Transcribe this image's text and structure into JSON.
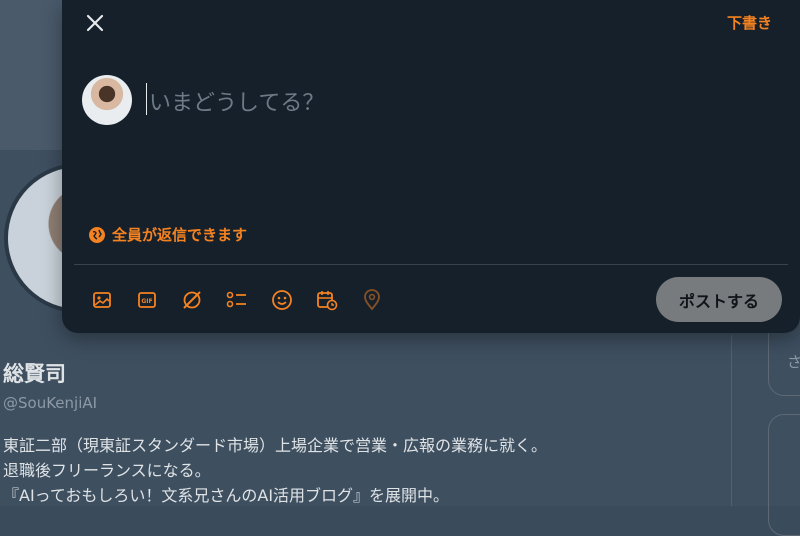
{
  "compose": {
    "draft_label": "下書き",
    "placeholder": "いまどうしてる？",
    "reply_setting": "全員が返信できます",
    "post_label": "ポストする",
    "toolbar_icons": [
      "image-icon",
      "gif-icon",
      "grok-icon",
      "poll-icon",
      "emoji-icon",
      "schedule-icon",
      "location-icon"
    ],
    "accent_color": "#f58220"
  },
  "profile": {
    "name": "総賢司",
    "handle": "@SouKenjiAI",
    "bio": [
      "東証二部（現東証スタンダード市場）上場企業で営業・広報の業務に就く。",
      "退職後フリーランスになる。",
      "『AIっておもしろい！文系兄さんのAI活用ブログ』を展開中。"
    ],
    "side_card_text": "さ"
  }
}
